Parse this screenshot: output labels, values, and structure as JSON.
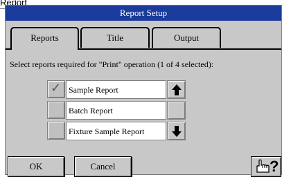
{
  "background_window": {
    "title_partial": "Report"
  },
  "dialog": {
    "title": "Report Setup",
    "tabs": [
      {
        "label": "Reports",
        "active": true
      },
      {
        "label": "Title",
        "active": false
      },
      {
        "label": "Output",
        "active": false
      }
    ],
    "prompt": "Select reports required for \"Print\" operation (1 of 4 selected):",
    "reports": [
      {
        "label": "Sample Report",
        "checked": true
      },
      {
        "label": "Batch Report",
        "checked": false
      },
      {
        "label": "Fixture Sample Report",
        "checked": false
      }
    ],
    "scroll": {
      "up_icon": "arrow-up-icon",
      "down_icon": "arrow-down-icon"
    },
    "buttons": {
      "ok": "OK",
      "cancel": "Cancel"
    },
    "help": {
      "icon": "pointing-hand-help-icon",
      "glyph": "?"
    },
    "colors": {
      "titlebar": "#1a3a9c",
      "dialog_bg": "#c8c8c8"
    }
  }
}
